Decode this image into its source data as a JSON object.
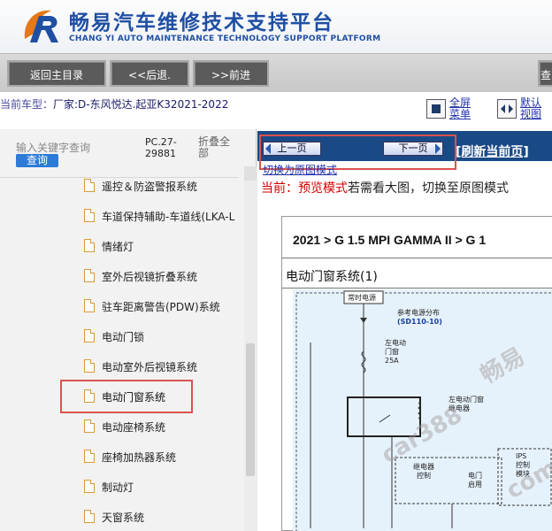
{
  "header": {
    "title": "畅易汽车维修技术支持平台",
    "subtitle": "CHANG YI AUTO MAINTENANCE TECHNOLOGY SUPPORT PLATFORM"
  },
  "nav": {
    "home": "返回主目录",
    "back": "<<后退.",
    "forward": ">>前进",
    "edge": "查"
  },
  "info": {
    "vehicle_label": "当前车型：",
    "vehicle": "厂家:D-东风悦达.起亚K32021-2022",
    "fullscreen_line1": "全屏",
    "fullscreen_line2": "菜单",
    "default_line1": "默认",
    "default_line2": "视图"
  },
  "left": {
    "search_placeholder": "输入关键字查询",
    "search_button": "查询",
    "pc_code": "PC.27-29881",
    "collapse": "折叠全部",
    "items": [
      "遥控＆防盗警报系统",
      "车道保持辅助-车道线(LKA-L",
      "情绪灯",
      "室外后视镜折叠系统",
      "驻车距离警告(PDW)系统",
      "电动门锁",
      "电动室外后视镜系统",
      "电动门窗系统",
      "电动座椅系统",
      "座椅加热器系统",
      "制动灯",
      "天窗系统"
    ]
  },
  "right": {
    "prev": "上一页",
    "next": "下一页",
    "refresh": "[刷新当前页]",
    "switch_link": "切换为原图模式",
    "current_prefix": "当前：预览模式",
    "current_suffix": "若需看大图，切换至原图模式",
    "breadcrumb": "2021 > G 1.5 MPI GAMMA II > G 1",
    "doc_title": "电动门窗系统(1)",
    "diagram": {
      "constant_power": "常时电源",
      "ref_line1": "参考电源分布",
      "ref_code": "(SD110-10)",
      "fuse_line1": "左电动",
      "fuse_line2": "门窗",
      "fuse_line3": "25A",
      "relay_line1": "左电动门窗",
      "relay_line2": "继电器",
      "relay_ctrl_line1": "继电器",
      "relay_ctrl_line2": "控制",
      "ips_line1": "IPS",
      "ips_line2": "控制",
      "ips_line3": "模块",
      "enable_line1": "电门",
      "enable_line2": "启用"
    },
    "watermark1": "畅易",
    "watermark2": "car388",
    "watermark3": "com"
  },
  "colors": {
    "brand_blue": "#1f4fa3",
    "pager_bar": "#1a4a86",
    "highlight_red": "#d9534f",
    "search_blue": "#2d7bd6"
  }
}
